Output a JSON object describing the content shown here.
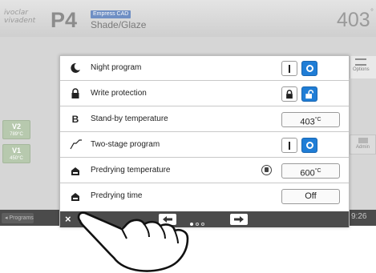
{
  "header": {
    "logo_line1": "ivoclar",
    "logo_line2": "vivadent",
    "program": "P4",
    "badge": "Empress CAD",
    "subtitle": "Shade/Glaze",
    "temperature": "403",
    "temperature_unit": "°"
  },
  "left_buttons": [
    {
      "label": "V2",
      "value": "789°C"
    },
    {
      "label": "V1",
      "value": "450°C"
    }
  ],
  "right_buttons": {
    "options": "Options",
    "admin": "Admin"
  },
  "dialog": {
    "rows": [
      {
        "label": "Night program",
        "icon": "moon-icon",
        "type": "toggle",
        "off": "I",
        "active": "on"
      },
      {
        "label": "Write protection",
        "icon": "lock-icon",
        "type": "toggle",
        "active": "unlocked"
      },
      {
        "label": "Stand-by temperature",
        "icon": "letter-b-icon",
        "type": "value",
        "value": "403",
        "unit": "°C"
      },
      {
        "label": "Two-stage program",
        "icon": "two-stage-curve-icon",
        "type": "toggle",
        "off": "I",
        "active": "on"
      },
      {
        "label": "Predrying temperature",
        "icon": "furnace-icon",
        "type": "value",
        "value": "600",
        "unit": "°C",
        "info": true
      },
      {
        "label": "Predrying time",
        "icon": "furnace-icon",
        "type": "value",
        "value": "Off"
      }
    ],
    "nav": {
      "close": "×",
      "page_dots": 3,
      "current_page": 1
    }
  },
  "bottom": {
    "programs": "◂ Programs",
    "clock": "9:26"
  },
  "colors": {
    "accent": "#1f7dd6",
    "header_bg": "#d9d9d9",
    "bar_bg": "#4b4b4b",
    "green_button": "#b7c9ae"
  }
}
